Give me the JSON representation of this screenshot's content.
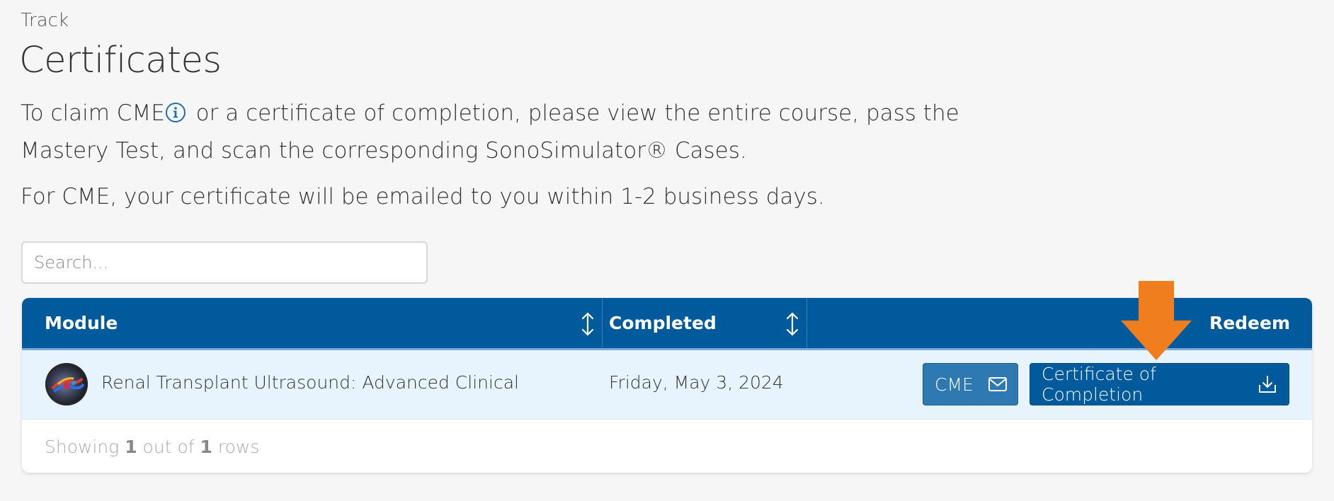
{
  "breadcrumb": "Track",
  "page_title": "Certificates",
  "intro": {
    "before": "To claim CME",
    "after": " or a certificate of completion, please view the entire course, pass the Mastery Test, and scan the corresponding SonoSimulator® Cases."
  },
  "note": "For CME, your certificate will be emailed to you within 1-2 business days.",
  "search": {
    "placeholder": "Search..."
  },
  "table": {
    "columns": [
      "Module",
      "Completed",
      "Redeem"
    ],
    "rows": [
      {
        "module": "Renal Transplant Ultrasound: Advanced Clinical",
        "completed": "Friday, May 3, 2024",
        "cme_label": "CME",
        "certificate_label": "Certificate of Completion"
      }
    ],
    "footer": {
      "prefix": "Showing ",
      "shown": "1",
      "middle": " out of ",
      "total": "1",
      "suffix": " rows"
    }
  },
  "colors": {
    "header_blue": "#005a9c",
    "cme_button": "#2f79b3",
    "row_highlight": "#e8f4fd",
    "arrow_orange": "#f07d1e"
  },
  "icons": [
    "info-icon",
    "sort-icon",
    "envelope-icon",
    "download-icon",
    "down-arrow-icon"
  ]
}
